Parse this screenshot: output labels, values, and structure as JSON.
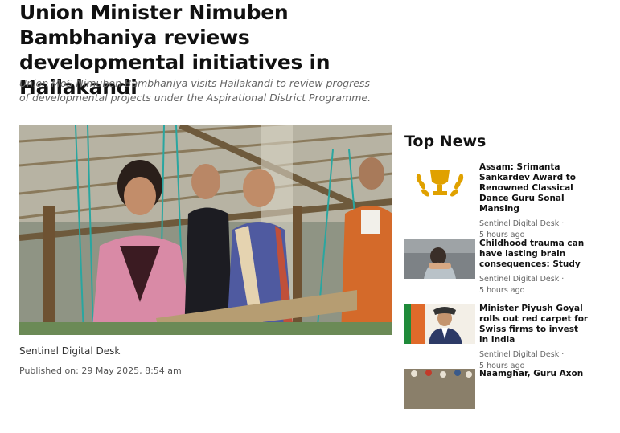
{
  "article": {
    "headline": "Union Minister Nimuben Bambhaniya reviews developmental initiatives in Hailakandi",
    "subheadline": "Union MoS Nimuben Bambhaniya visits Hailakandi to review progress of developmental projects under the Aspirational District Programme.",
    "author": "Sentinel Digital Desk",
    "published": "Published on: 29 May 2025, 8:54 am"
  },
  "sidebar": {
    "title": "Top News",
    "items": [
      {
        "title": "Assam: Srimanta Sankardev Award to Renowned Classical Dance Guru Sonal Mansing",
        "source": "Sentinel Digital Desk",
        "separator": "·",
        "time": "5 hours ago",
        "thumb_icon": "trophy-icon"
      },
      {
        "title": "Childhood trauma can have lasting brain consequences: Study",
        "source": "Sentinel Digital Desk",
        "separator": "·",
        "time": "5 hours ago",
        "thumb_icon": "photo-child-icon"
      },
      {
        "title": "Minister Piyush Goyal rolls out red carpet for Swiss firms to invest in India",
        "source": "Sentinel Digital Desk",
        "separator": "·",
        "time": "5 hours ago",
        "thumb_icon": "photo-minister-icon"
      },
      {
        "title": "Naamghar, Guru Axon",
        "source": "",
        "separator": "",
        "time": "",
        "thumb_icon": "photo-crowd-icon"
      }
    ]
  },
  "colors": {
    "text": "#111111",
    "muted": "#666666",
    "trophy_gold": "#e0a100"
  }
}
